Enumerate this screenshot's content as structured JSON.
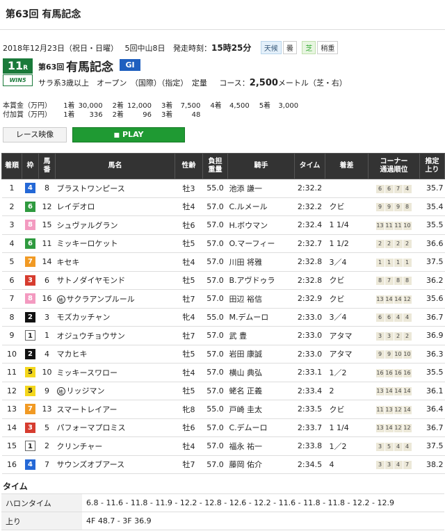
{
  "page_title": "第63回 有馬記念",
  "info": {
    "date": "2018年12月23日（祝日・日曜）",
    "meeting": "5回中山8日",
    "post_time_label": "発走時刻：",
    "post_time": "15時25分",
    "weather_label": "天候",
    "weather": "曇",
    "track_label": "芝",
    "track_condition": "稍重"
  },
  "race": {
    "number": "11",
    "number_suffix": "R",
    "wins_logo": "WIN5",
    "count": "第63回",
    "name": "有馬記念",
    "grade": "GI",
    "conditions": "サラ系3歳以上　オープン　（国際）（指定）　定量",
    "course_label": "コース：",
    "distance": "2,500",
    "distance_unit": "メートル（芝・右）"
  },
  "prize": {
    "main_label": "本賞金（万円）",
    "main": [
      {
        "place": "1着",
        "amount": "30,000"
      },
      {
        "place": "2着",
        "amount": "12,000"
      },
      {
        "place": "3着",
        "amount": "7,500"
      },
      {
        "place": "4着",
        "amount": "4,500"
      },
      {
        "place": "5着",
        "amount": "3,000"
      }
    ],
    "add_label": "付加賞（万円）",
    "add": [
      {
        "place": "1着",
        "amount": "336"
      },
      {
        "place": "2着",
        "amount": "96"
      },
      {
        "place": "3着",
        "amount": "48"
      }
    ]
  },
  "buttons": {
    "video": "レース映像",
    "play": "PLAY"
  },
  "table": {
    "headers": {
      "rank": "着順",
      "waku": "枠",
      "num_1": "馬",
      "num_2": "番",
      "name": "馬名",
      "sex_age": "性齢",
      "weight_1": "負担",
      "weight_2": "重量",
      "jockey": "騎手",
      "time": "タイム",
      "margin": "着差",
      "corner_1": "コーナー",
      "corner_2": "通過順位",
      "last3f_1": "推定",
      "last3f_2": "上り"
    },
    "rows": [
      {
        "rank": "1",
        "waku": 4,
        "num": "8",
        "mark": "",
        "name": "ブラストワンピース",
        "sex_age": "牡3",
        "weight": "55.0",
        "jockey": "池添 謙一",
        "time": "2:32.2",
        "margin": "",
        "corners": [
          "6",
          "6",
          "7",
          "4"
        ],
        "last3f": "35.7"
      },
      {
        "rank": "2",
        "waku": 6,
        "num": "12",
        "mark": "",
        "name": "レイデオロ",
        "sex_age": "牡4",
        "weight": "57.0",
        "jockey": "C.ルメール",
        "time": "2:32.2",
        "margin": "クビ",
        "corners": [
          "9",
          "9",
          "9",
          "8"
        ],
        "last3f": "35.4"
      },
      {
        "rank": "3",
        "waku": 8,
        "num": "15",
        "mark": "",
        "name": "シュヴァルグラン",
        "sex_age": "牡6",
        "weight": "57.0",
        "jockey": "H.ボウマン",
        "time": "2:32.4",
        "margin": "1 1/4",
        "corners": [
          "13",
          "11",
          "11",
          "10"
        ],
        "last3f": "35.5"
      },
      {
        "rank": "4",
        "waku": 6,
        "num": "11",
        "mark": "",
        "name": "ミッキーロケット",
        "sex_age": "牡5",
        "weight": "57.0",
        "jockey": "O.マーフィー",
        "time": "2:32.7",
        "margin": "1 1/2",
        "corners": [
          "2",
          "2",
          "2",
          "2"
        ],
        "last3f": "36.6"
      },
      {
        "rank": "5",
        "waku": 7,
        "num": "14",
        "mark": "",
        "name": "キセキ",
        "sex_age": "牡4",
        "weight": "57.0",
        "jockey": "川田 将雅",
        "time": "2:32.8",
        "margin": "3／4",
        "corners": [
          "1",
          "1",
          "1",
          "1"
        ],
        "last3f": "37.5"
      },
      {
        "rank": "6",
        "waku": 3,
        "num": "6",
        "mark": "",
        "name": "サトノダイヤモンド",
        "sex_age": "牡5",
        "weight": "57.0",
        "jockey": "B.アヴドゥラ",
        "time": "2:32.8",
        "margin": "クビ",
        "corners": [
          "8",
          "7",
          "8",
          "8"
        ],
        "last3f": "36.2"
      },
      {
        "rank": "7",
        "waku": 8,
        "num": "16",
        "mark": "地",
        "name": "サクラアンプルール",
        "sex_age": "牡7",
        "weight": "57.0",
        "jockey": "田辺 裕信",
        "time": "2:32.9",
        "margin": "クビ",
        "corners": [
          "13",
          "14",
          "14",
          "12"
        ],
        "last3f": "35.6"
      },
      {
        "rank": "8",
        "waku": 2,
        "num": "3",
        "mark": "",
        "name": "モズカッチャン",
        "sex_age": "牝4",
        "weight": "55.0",
        "jockey": "M.デムーロ",
        "time": "2:33.0",
        "margin": "3／4",
        "corners": [
          "6",
          "6",
          "4",
          "4"
        ],
        "last3f": "36.7"
      },
      {
        "rank": "9",
        "waku": 1,
        "num": "1",
        "mark": "",
        "name": "オジュウチョウサン",
        "sex_age": "牡7",
        "weight": "57.0",
        "jockey": "武 豊",
        "time": "2:33.0",
        "margin": "アタマ",
        "corners": [
          "3",
          "3",
          "2",
          "2"
        ],
        "last3f": "36.9"
      },
      {
        "rank": "10",
        "waku": 2,
        "num": "4",
        "mark": "",
        "name": "マカヒキ",
        "sex_age": "牡5",
        "weight": "57.0",
        "jockey": "岩田 康誠",
        "time": "2:33.0",
        "margin": "アタマ",
        "corners": [
          "9",
          "9",
          "10",
          "10"
        ],
        "last3f": "36.3"
      },
      {
        "rank": "11",
        "waku": 5,
        "num": "10",
        "mark": "",
        "name": "ミッキースワロー",
        "sex_age": "牡4",
        "weight": "57.0",
        "jockey": "横山 典弘",
        "time": "2:33.1",
        "margin": "1／2",
        "corners": [
          "16",
          "16",
          "16",
          "16"
        ],
        "last3f": "35.5"
      },
      {
        "rank": "12",
        "waku": 5,
        "num": "9",
        "mark": "地",
        "name": "リッジマン",
        "sex_age": "牡5",
        "weight": "57.0",
        "jockey": "蛯名 正義",
        "time": "2:33.4",
        "margin": "2",
        "corners": [
          "13",
          "14",
          "14",
          "14"
        ],
        "last3f": "36.1"
      },
      {
        "rank": "13",
        "waku": 7,
        "num": "13",
        "mark": "",
        "name": "スマートレイアー",
        "sex_age": "牝8",
        "weight": "55.0",
        "jockey": "戸崎 圭太",
        "time": "2:33.5",
        "margin": "クビ",
        "corners": [
          "11",
          "13",
          "12",
          "14"
        ],
        "last3f": "36.4"
      },
      {
        "rank": "14",
        "waku": 3,
        "num": "5",
        "mark": "",
        "name": "パフォーマプロミス",
        "sex_age": "牡6",
        "weight": "57.0",
        "jockey": "C.デムーロ",
        "time": "2:33.7",
        "margin": "1 1/4",
        "corners": [
          "13",
          "14",
          "12",
          "12"
        ],
        "last3f": "36.7"
      },
      {
        "rank": "15",
        "waku": 1,
        "num": "2",
        "mark": "",
        "name": "クリンチャー",
        "sex_age": "牡4",
        "weight": "57.0",
        "jockey": "福永 祐一",
        "time": "2:33.8",
        "margin": "1／2",
        "corners": [
          "3",
          "5",
          "4",
          "4"
        ],
        "last3f": "37.5"
      },
      {
        "rank": "16",
        "waku": 4,
        "num": "7",
        "mark": "",
        "name": "サウンズオブアース",
        "sex_age": "牡7",
        "weight": "57.0",
        "jockey": "藤岡 佑介",
        "time": "2:34.5",
        "margin": "4",
        "corners": [
          "3",
          "3",
          "4",
          "7"
        ],
        "last3f": "38.2"
      }
    ]
  },
  "timing": {
    "title": "タイム",
    "furlong_label": "ハロンタイム",
    "furlong": "6.8 - 11.6 - 11.8 - 11.9 - 12.2 - 12.8 - 12.6 - 12.2 - 11.6 - 11.8 - 11.8 - 12.2 - 12.9",
    "final_label": "上り",
    "final": "4F 48.7 - 3F 36.9"
  }
}
